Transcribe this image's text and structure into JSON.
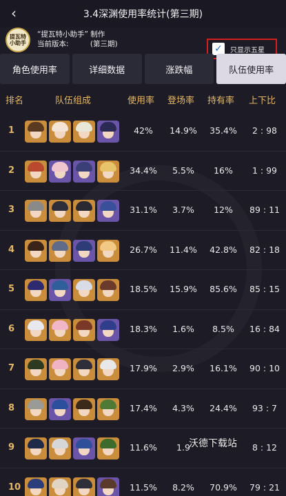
{
  "header": {
    "back_icon": "back-arrow-icon",
    "title": "3.4深渊使用率统计(第三期)"
  },
  "credit": {
    "logo_text": [
      "提瓦特",
      "小助手"
    ],
    "maker": "“提瓦特小助手” 制作",
    "version_label": "当前版本:",
    "version_period": "(第三期)"
  },
  "filter": {
    "checked": true,
    "label": "只显示五星"
  },
  "tabs": [
    {
      "label": "角色使用率",
      "active": false
    },
    {
      "label": "详细数据",
      "active": false
    },
    {
      "label": "涨跌幅",
      "active": false
    },
    {
      "label": "队伍使用率",
      "active": true
    }
  ],
  "table": {
    "columns": {
      "rank": "排名",
      "team": "队伍组成",
      "usage": "使用率",
      "appearance": "登场率",
      "ownership": "持有率",
      "ratio": "上下比"
    },
    "rows": [
      {
        "rank": "1",
        "usage": "42%",
        "appearance": "14.9%",
        "ownership": "35.4%",
        "ratio": "2 : 98"
      },
      {
        "rank": "2",
        "usage": "34.4%",
        "appearance": "5.5%",
        "ownership": "16%",
        "ratio": "1 : 99"
      },
      {
        "rank": "3",
        "usage": "31.1%",
        "appearance": "3.7%",
        "ownership": "12%",
        "ratio": "89 : 11"
      },
      {
        "rank": "4",
        "usage": "26.7%",
        "appearance": "11.4%",
        "ownership": "42.8%",
        "ratio": "82 : 18"
      },
      {
        "rank": "5",
        "usage": "18.5%",
        "appearance": "15.9%",
        "ownership": "85.6%",
        "ratio": "85 : 15"
      },
      {
        "rank": "6",
        "usage": "18.3%",
        "appearance": "1.6%",
        "ownership": "8.5%",
        "ratio": "16 : 84"
      },
      {
        "rank": "7",
        "usage": "17.9%",
        "appearance": "2.9%",
        "ownership": "16.1%",
        "ratio": "90 : 10"
      },
      {
        "rank": "8",
        "usage": "17.4%",
        "appearance": "4.3%",
        "ownership": "24.4%",
        "ratio": "93 : 7"
      },
      {
        "rank": "9",
        "usage": "11.6%",
        "appearance": "1.9",
        "ownership": "",
        "ratio": "8 : 12"
      },
      {
        "rank": "10",
        "usage": "11.5%",
        "appearance": "8.2%",
        "ownership": "70.9%",
        "ratio": "79 : 21"
      }
    ],
    "avatar_frames": {
      "gold": "#c98d3b",
      "purple": "#6a55a8"
    }
  },
  "watermark": "沃德下载站",
  "colors": {
    "background": "#1d1b26",
    "header_text": "#e6b864",
    "highlight_box": "#d41f1f",
    "active_tab": "#dcd9e4"
  }
}
